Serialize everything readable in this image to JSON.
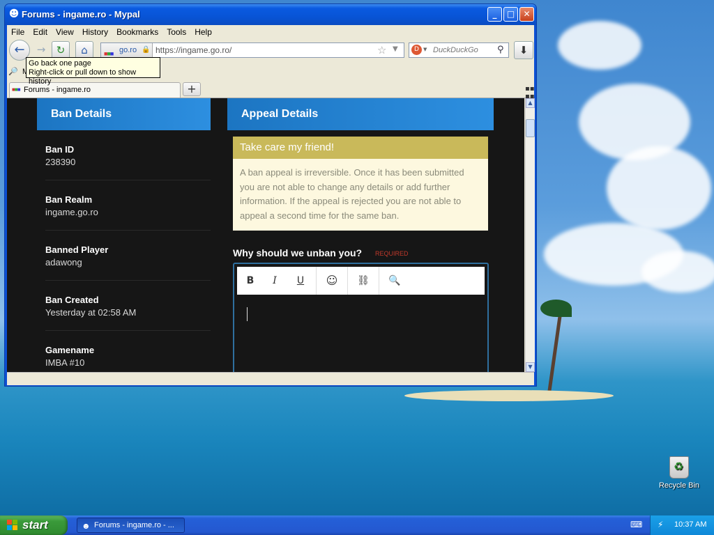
{
  "window": {
    "title": "Forums - ingame.ro - Mypal"
  },
  "menu": [
    "File",
    "Edit",
    "View",
    "History",
    "Bookmarks",
    "Tools",
    "Help"
  ],
  "navbar": {
    "identity_label": "go.ro",
    "url": "https://ingame.go.ro/",
    "search_placeholder": "DuckDuckGo"
  },
  "bookmarks": {
    "label": "M"
  },
  "tooltip": {
    "line1": "Go back one page",
    "line2": "Right-click or pull down to show history"
  },
  "tabs": [
    {
      "label": "Forums - ingame.ro"
    }
  ],
  "page": {
    "ban_details_title": "Ban Details",
    "appeal_details_title": "Appeal Details",
    "details": [
      {
        "label": "Ban ID",
        "value": "238390"
      },
      {
        "label": "Ban Realm",
        "value": "ingame.go.ro"
      },
      {
        "label": "Banned Player",
        "value": "adawong"
      },
      {
        "label": "Ban Created",
        "value": "Yesterday at 02:58 AM"
      },
      {
        "label": "Gamename",
        "value": "IMBA #10"
      }
    ],
    "notice_title": "Take care my friend!",
    "notice_body": "A ban appeal is irreversible. Once it has been submitted you are not able to change any details or add further information. If the appeal is rejected you are not able to appeal a second time for the same ban.",
    "question": "Why should we unban you?",
    "required": "REQUIRED",
    "toolbar": {
      "bold": "B",
      "italic": "I",
      "underline": "U"
    }
  },
  "desktop": {
    "recycle_bin": "Recycle Bin"
  },
  "taskbar": {
    "start": "start",
    "task": "Forums - ingame.ro - ...",
    "clock": "10:37 AM"
  }
}
